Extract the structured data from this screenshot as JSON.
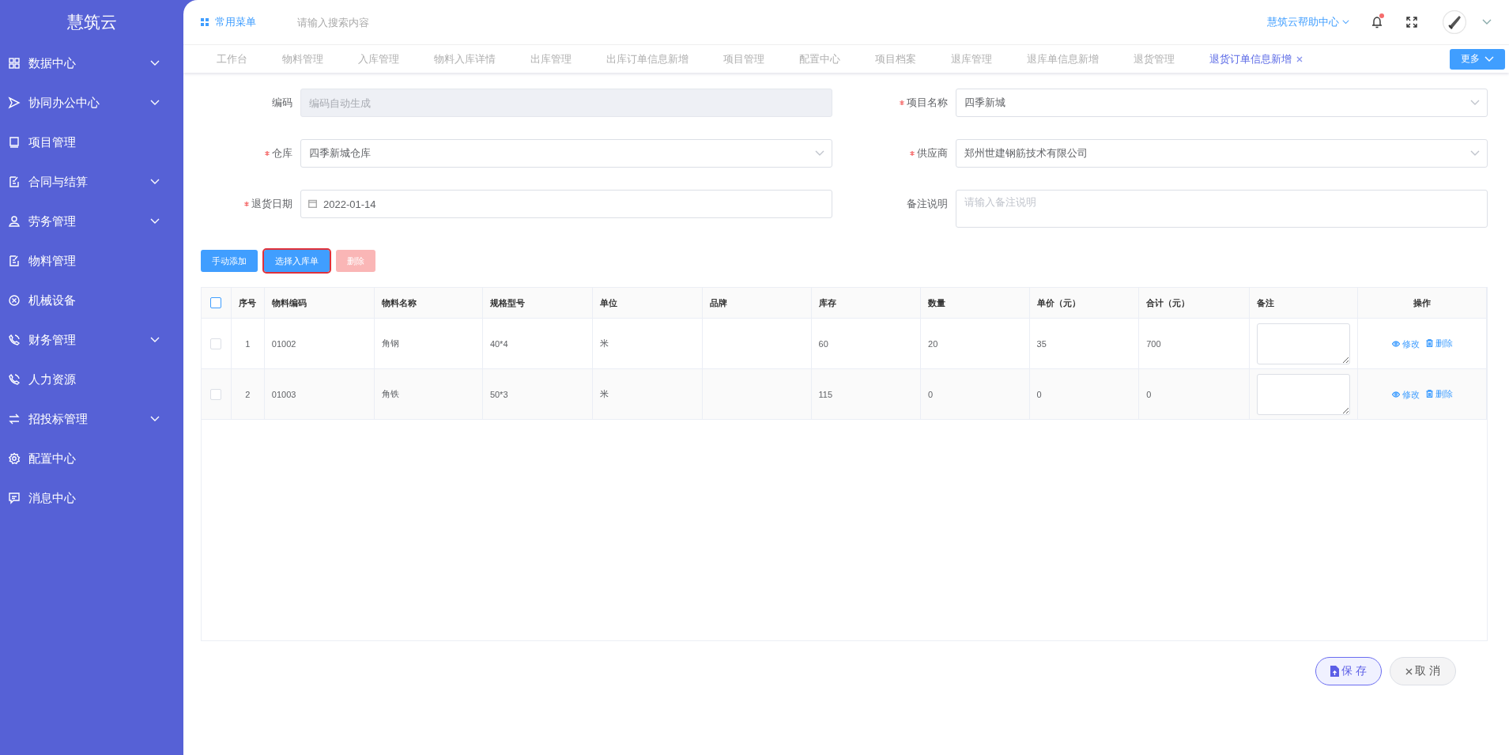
{
  "sidebar": {
    "logo": "慧筑云",
    "items": [
      {
        "label": "数据中心",
        "has_submenu": true
      },
      {
        "label": "协同办公中心",
        "has_submenu": true
      },
      {
        "label": "项目管理",
        "has_submenu": false
      },
      {
        "label": "合同与结算",
        "has_submenu": true
      },
      {
        "label": "劳务管理",
        "has_submenu": true
      },
      {
        "label": "物料管理",
        "has_submenu": false
      },
      {
        "label": "机械设备",
        "has_submenu": false
      },
      {
        "label": "财务管理",
        "has_submenu": true
      },
      {
        "label": "人力资源",
        "has_submenu": false
      },
      {
        "label": "招投标管理",
        "has_submenu": true
      },
      {
        "label": "配置中心",
        "has_submenu": false
      },
      {
        "label": "消息中心",
        "has_submenu": false
      }
    ]
  },
  "header": {
    "menu_label": "常用菜单",
    "search": {
      "placeholder": "请输入搜索内容"
    },
    "help_link": "慧筑云帮助中心",
    "has_notification": true
  },
  "tabs": [
    {
      "label": "工作台",
      "selected": false
    },
    {
      "label": "物料管理",
      "selected": false
    },
    {
      "label": "入库管理",
      "selected": false
    },
    {
      "label": "物料入库详情",
      "selected": false
    },
    {
      "label": "出库管理",
      "selected": false
    },
    {
      "label": "出库订单信息新增",
      "selected": false
    },
    {
      "label": "项目管理",
      "selected": false
    },
    {
      "label": "配置中心",
      "selected": false
    },
    {
      "label": "项目档案",
      "selected": false
    },
    {
      "label": "退库管理",
      "selected": false
    },
    {
      "label": "退库单信息新增",
      "selected": false
    },
    {
      "label": "退货管理",
      "selected": false
    },
    {
      "label": "退货订单信息新增",
      "selected": true
    }
  ],
  "more_button": "更多",
  "form": {
    "fields": [
      {
        "label": "编码",
        "required": false,
        "kind": "input",
        "placeholder": "编码自动生成",
        "disabled": true
      },
      {
        "label": "项目名称",
        "required": true,
        "kind": "select",
        "value": "四季新城",
        "disabled": false
      },
      {
        "label": "仓库",
        "required": true,
        "kind": "select",
        "value": "四季新城仓库",
        "disabled": false
      },
      {
        "label": "供应商",
        "required": true,
        "kind": "select",
        "value": "郑州世建钢筋技术有限公司",
        "disabled": false
      },
      {
        "label": "退货日期",
        "required": true,
        "kind": "date",
        "value": "2022-01-14",
        "disabled": false
      },
      {
        "label": "备注说明",
        "required": false,
        "kind": "textarea",
        "placeholder": "请输入备注说明",
        "disabled": false
      }
    ]
  },
  "actions": [
    {
      "label": "手动添加",
      "disabled": false,
      "focused": false
    },
    {
      "label": "选择入库单",
      "disabled": false,
      "focused": true
    },
    {
      "label": "删除",
      "disabled": true,
      "focused": false
    }
  ],
  "table": {
    "all_checked": false,
    "columns": [
      "序号",
      "物料编码",
      "物料名称",
      "规格型号",
      "单位",
      "品牌",
      "库存",
      "数量",
      "单价（元）",
      "合计（元）",
      "备注",
      "操作"
    ],
    "rows": [
      {
        "checked": false,
        "cells": [
          "1",
          "01002",
          "角钢",
          "40*4",
          "米",
          "",
          "60",
          "20",
          "35",
          "700"
        ],
        "actions": [
          "修改",
          "删除"
        ]
      },
      {
        "checked": false,
        "cells": [
          "2",
          "01003",
          "角铁",
          "50*3",
          "米",
          "",
          "115",
          "0",
          "0",
          "0"
        ],
        "actions": [
          "修改",
          "删除"
        ]
      }
    ]
  },
  "footer": {
    "save": "保 存",
    "cancel": "取 消"
  }
}
